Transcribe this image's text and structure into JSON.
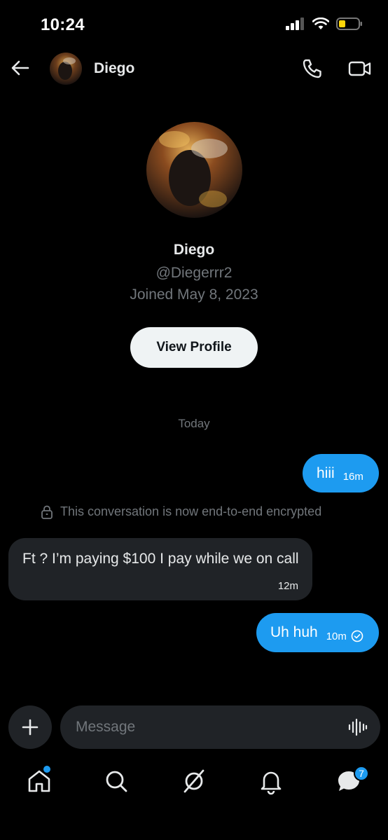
{
  "status_bar": {
    "time": "10:24"
  },
  "header": {
    "contact_name": "Diego"
  },
  "profile": {
    "name": "Diego",
    "handle": "@Diegerrr2",
    "joined": "Joined May 8, 2023",
    "view_profile_label": "View Profile"
  },
  "conversation": {
    "date_divider": "Today",
    "encryption_notice": "This conversation is now end-to-end encrypted",
    "messages": [
      {
        "direction": "outgoing",
        "text": "hiii",
        "time": "16m"
      },
      {
        "direction": "incoming",
        "text": "Ft ? I’m paying $100 I pay while we on call",
        "time": "12m"
      },
      {
        "direction": "outgoing",
        "text": "Uh huh",
        "time": "10m",
        "status": "seen-check-icon"
      }
    ]
  },
  "composer": {
    "placeholder": "Message"
  },
  "bottom_nav": {
    "items": [
      "home-icon",
      "search-icon",
      "grok-icon",
      "notifications-bell-icon",
      "messages-icon"
    ],
    "messages_badge": "7"
  },
  "colors": {
    "accent": "#1d9bf0",
    "background": "#000000",
    "incoming_bubble": "#202327",
    "muted_text": "#71767b"
  }
}
